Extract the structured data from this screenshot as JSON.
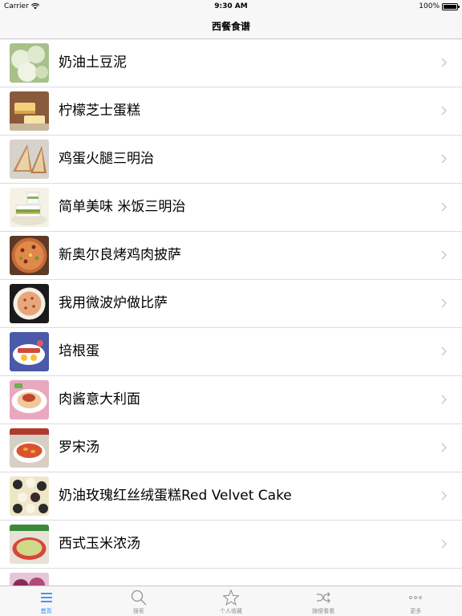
{
  "status_bar": {
    "carrier": "Carrier",
    "time": "9:30 AM",
    "battery": "100%",
    "battery_level": 1.0
  },
  "nav": {
    "title": "西餐食谱"
  },
  "recipes": [
    {
      "label": "奶油土豆泥",
      "thumb": "potato"
    },
    {
      "label": "柠檬芝士蛋糕",
      "thumb": "cheesecake"
    },
    {
      "label": "鸡蛋火腿三明治",
      "thumb": "sandwich"
    },
    {
      "label": "简单美味  米饭三明治",
      "thumb": "rice-sandwich"
    },
    {
      "label": "新奥尔良烤鸡肉披萨",
      "thumb": "pizza"
    },
    {
      "label": "我用微波炉做比萨",
      "thumb": "microwave-pizza"
    },
    {
      "label": "培根蛋",
      "thumb": "bacon-egg"
    },
    {
      "label": "肉酱意大利面",
      "thumb": "pasta"
    },
    {
      "label": "罗宋汤",
      "thumb": "borscht"
    },
    {
      "label": "奶油玫瑰红丝绒蛋糕Red Velvet Cake",
      "thumb": "red-velvet"
    },
    {
      "label": "西式玉米浓汤",
      "thumb": "corn-soup"
    },
    {
      "label": "",
      "thumb": "partial"
    }
  ],
  "tabs": [
    {
      "label": "首页",
      "icon": "list-icon",
      "active": true
    },
    {
      "label": "搜索",
      "icon": "search-icon",
      "active": false
    },
    {
      "label": "个人收藏",
      "icon": "star-icon",
      "active": false
    },
    {
      "label": "随便看看",
      "icon": "shuffle-icon",
      "active": false
    },
    {
      "label": "更多",
      "icon": "more-icon",
      "active": false
    }
  ],
  "colors": {
    "accent": "#1f7bf6",
    "inactive": "#929292",
    "bar": "#f7f7f7",
    "separator": "#dcdcdf"
  }
}
